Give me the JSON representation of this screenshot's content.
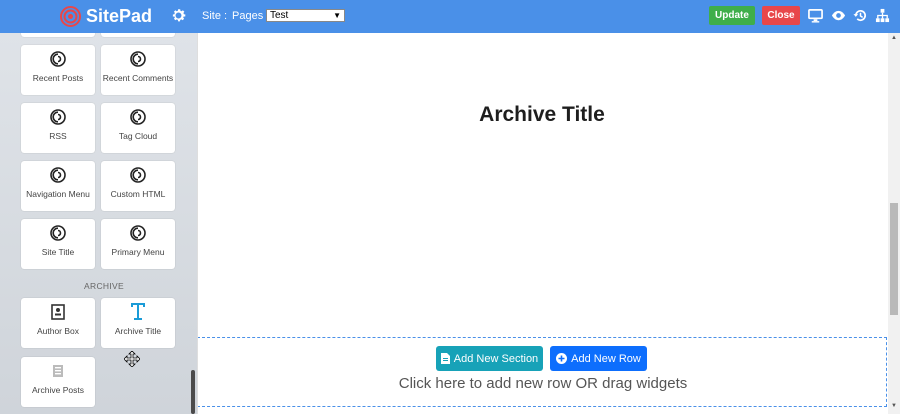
{
  "brand": {
    "name": "SitePad",
    "logo_icon": "spiral-logo-icon",
    "color": "#e8474a"
  },
  "topbar": {
    "site_label": "Site :",
    "pages_label": "Pages :",
    "page_select_value": "Test",
    "update_label": "Update",
    "close_label": "Close",
    "icons": [
      "desktop-icon",
      "eye-icon",
      "history-icon",
      "sitemap-icon"
    ],
    "bg_color": "#4a90e8"
  },
  "sidebar": {
    "widgets_top": [
      {
        "label": "Recent Posts",
        "icon": "wordpress-icon"
      },
      {
        "label": "Recent Comments",
        "icon": "wordpress-icon"
      },
      {
        "label": "RSS",
        "icon": "wordpress-icon"
      },
      {
        "label": "Tag Cloud",
        "icon": "wordpress-icon"
      },
      {
        "label": "Navigation Menu",
        "icon": "wordpress-icon"
      },
      {
        "label": "Custom HTML",
        "icon": "wordpress-icon"
      },
      {
        "label": "Site Title",
        "icon": "wordpress-icon"
      },
      {
        "label": "Primary Menu",
        "icon": "wordpress-icon"
      }
    ],
    "archive_section_title": "ARCHIVE",
    "widgets_archive": [
      {
        "label": "Author Box",
        "icon": "author-box-icon"
      },
      {
        "label": "Archive Title",
        "icon": "title-t-icon"
      },
      {
        "label": "Archive Posts",
        "icon": "archive-posts-icon"
      }
    ]
  },
  "canvas": {
    "archive_title": "Archive Title",
    "add_section_label": "Add New Section",
    "add_row_label": "Add New Row",
    "drop_hint": "Click here to add new row OR drag widgets"
  }
}
